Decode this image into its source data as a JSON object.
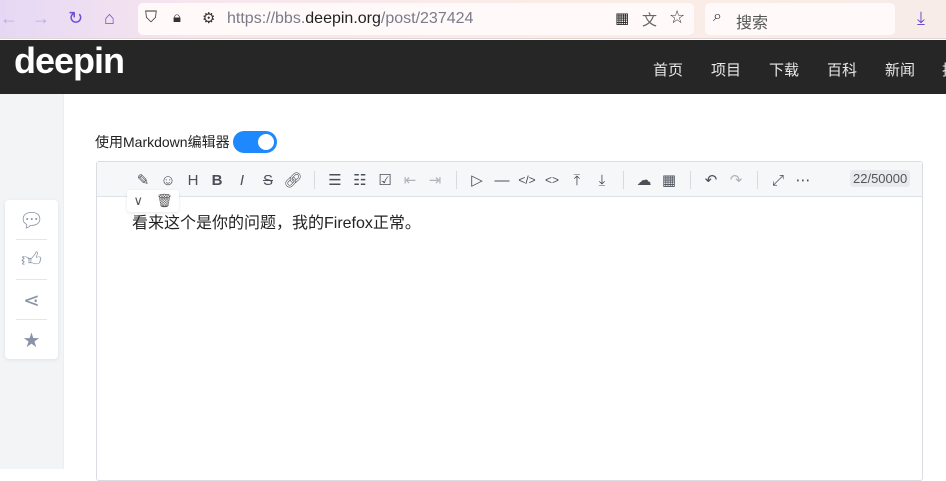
{
  "browser": {
    "url_prefix": "https://bbs.",
    "url_domain": "deepin.org",
    "url_path": "/post/237424",
    "search_placeholder": "搜索"
  },
  "header": {
    "logo": "deepin",
    "nav": [
      "首页",
      "项目",
      "下载",
      "百科",
      "新闻",
      "技"
    ]
  },
  "editor": {
    "markdown_label": "使用Markdown编辑器",
    "markdown_enabled": true,
    "counter": "22/50000",
    "content": "看来这个是你的问题，我的Firefox正常。"
  },
  "colors": {
    "accent": "#1e88ff",
    "header_bg": "#262626"
  }
}
